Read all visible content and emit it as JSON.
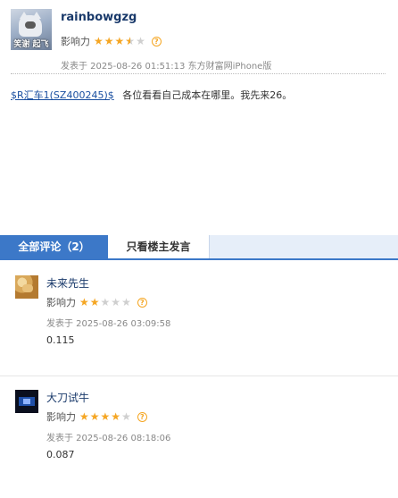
{
  "post": {
    "author": "rainbowgzg",
    "avatar_text": "笑谢 起飞",
    "influence_label": "影响力",
    "stars": 3.5,
    "help_icon": "question-circle-icon",
    "meta": "发表于 2025-08-26 01:51:13 东方财富网iPhone版",
    "stock_link": "$R汇车1(SZ400245)$",
    "content": "各位看看自己成本在哪里。我先来26。"
  },
  "tabs": {
    "all_label": "全部评论（2）",
    "owner_label": "只看楼主发言"
  },
  "comments": [
    {
      "author": "未来先生",
      "influence_label": "影响力",
      "stars": 2,
      "meta": "发表于 2025-08-26 03:09:58",
      "text": "0.115"
    },
    {
      "author": "大刀试牛",
      "influence_label": "影响力",
      "stars": 4,
      "meta": "发表于 2025-08-26 08:18:06",
      "text": "0.087"
    }
  ],
  "colors": {
    "star": "#f5a623",
    "tab_active": "#3c78c8",
    "link": "#1a4fa0"
  }
}
